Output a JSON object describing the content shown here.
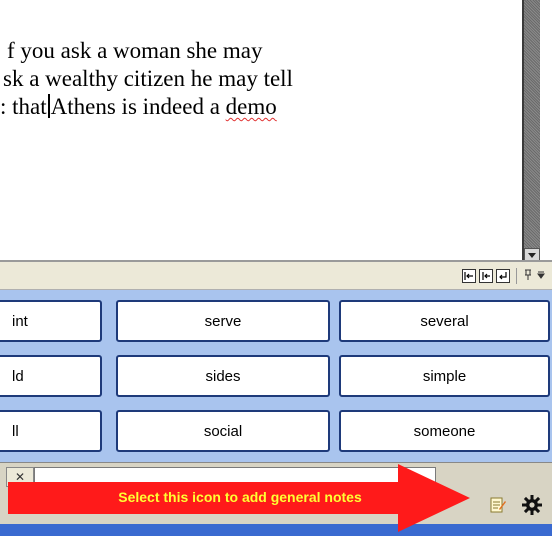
{
  "document": {
    "lines": [
      "f you ask a woman she may",
      "sk a wealthy citizen he may tell",
      ": that",
      "Athens is indeed a ",
      "demo"
    ]
  },
  "toolbar": {
    "icons": [
      "align-left-icon",
      "indent-icon",
      "return-icon",
      "pin-icon",
      "dropdown-icon"
    ]
  },
  "words": {
    "rows": [
      [
        "int",
        "serve",
        "several"
      ],
      [
        "ld",
        "sides",
        "simple"
      ],
      [
        "ll",
        "social",
        "someone"
      ]
    ]
  },
  "bottom": {
    "tab_glyph": "✕"
  },
  "callout": {
    "text": "Select this icon to add general notes",
    "arrow_color": "#ff1a1a",
    "text_color": "#ffff33"
  },
  "colors": {
    "grid_background": "#a9c4ee",
    "word_border": "#1e3a7a",
    "toolbar": "#ece9d8"
  }
}
